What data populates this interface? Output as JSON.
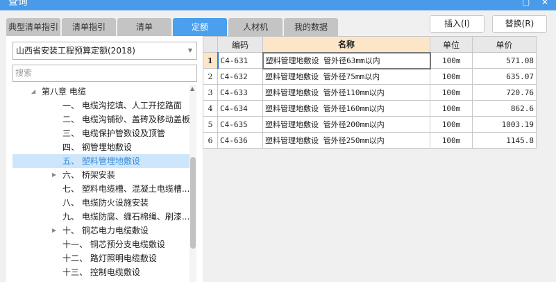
{
  "window": {
    "title": "查询"
  },
  "tabs": [
    {
      "label": "典型清单指引"
    },
    {
      "label": "清单指引"
    },
    {
      "label": "清单"
    },
    {
      "label": "定额",
      "active": true
    },
    {
      "label": "人材机"
    },
    {
      "label": "我的数据"
    }
  ],
  "buttons": {
    "insert": "插入(I)",
    "replace": "替换(R)"
  },
  "left": {
    "quota_library": "山西省安装工程预算定额(2018)",
    "search_placeholder": "搜索",
    "tree": [
      {
        "label": "第八章 电缆",
        "level": 0,
        "expanded": true
      },
      {
        "label": "一、 电缆沟挖填、人工开挖路面",
        "level": 1
      },
      {
        "label": "二、 电缆沟铺砂、盖砖及移动盖板",
        "level": 1
      },
      {
        "label": "三、 电缆保护管数设及顶管",
        "level": 1
      },
      {
        "label": "四、 钢管埋地敷设",
        "level": 1
      },
      {
        "label": "五、 塑料管埋地敷设",
        "level": 1,
        "selected": true
      },
      {
        "label": "六、 桥架安装",
        "level": 1,
        "collapsed": true
      },
      {
        "label": "七、 塑料电缆槽、混凝土电缆槽...",
        "level": 1
      },
      {
        "label": "八、 电缆防火设施安装",
        "level": 1
      },
      {
        "label": "九、 电缆防腐、缠石棉绳、刷漆...",
        "level": 1
      },
      {
        "label": "十、 铜芯电力电缆敷设",
        "level": 1,
        "collapsed": true
      },
      {
        "label": "十一、 铜芯预分支电缆敷设",
        "level": 1
      },
      {
        "label": "十二、 路灯照明电缆敷设",
        "level": 1
      },
      {
        "label": "十三、 控制电缆敷设",
        "level": 1
      }
    ]
  },
  "table": {
    "headers": {
      "num": "",
      "code": "编码",
      "name": "名称",
      "unit": "单位",
      "price": "单价"
    },
    "rows": [
      {
        "num": "1",
        "code": "C4-631",
        "name": "塑料管理地敷设 管外径63mm以内",
        "unit": "100m",
        "price": "571.08"
      },
      {
        "num": "2",
        "code": "C4-632",
        "name": "塑料管理地敷设 管外径75mm以内",
        "unit": "100m",
        "price": "635.07"
      },
      {
        "num": "3",
        "code": "C4-633",
        "name": "塑料管理地敷设 管外径110mm以内",
        "unit": "100m",
        "price": "720.76"
      },
      {
        "num": "4",
        "code": "C4-634",
        "name": "塑料管理地敷设 管外径160mm以内",
        "unit": "100m",
        "price": "862.6"
      },
      {
        "num": "5",
        "code": "C4-635",
        "name": "塑料管理地敷设 管外径200mm以内",
        "unit": "100m",
        "price": "1003.19"
      },
      {
        "num": "6",
        "code": "C4-636",
        "name": "塑料管理地敷设 管外径250mm以内",
        "unit": "100m",
        "price": "1145.8"
      }
    ]
  },
  "colors": {
    "titlebar": "#4a9aea",
    "active_tab": "#4aa0ee",
    "selected_node": "#cde6fb",
    "header_highlight": "#fde6c8"
  }
}
